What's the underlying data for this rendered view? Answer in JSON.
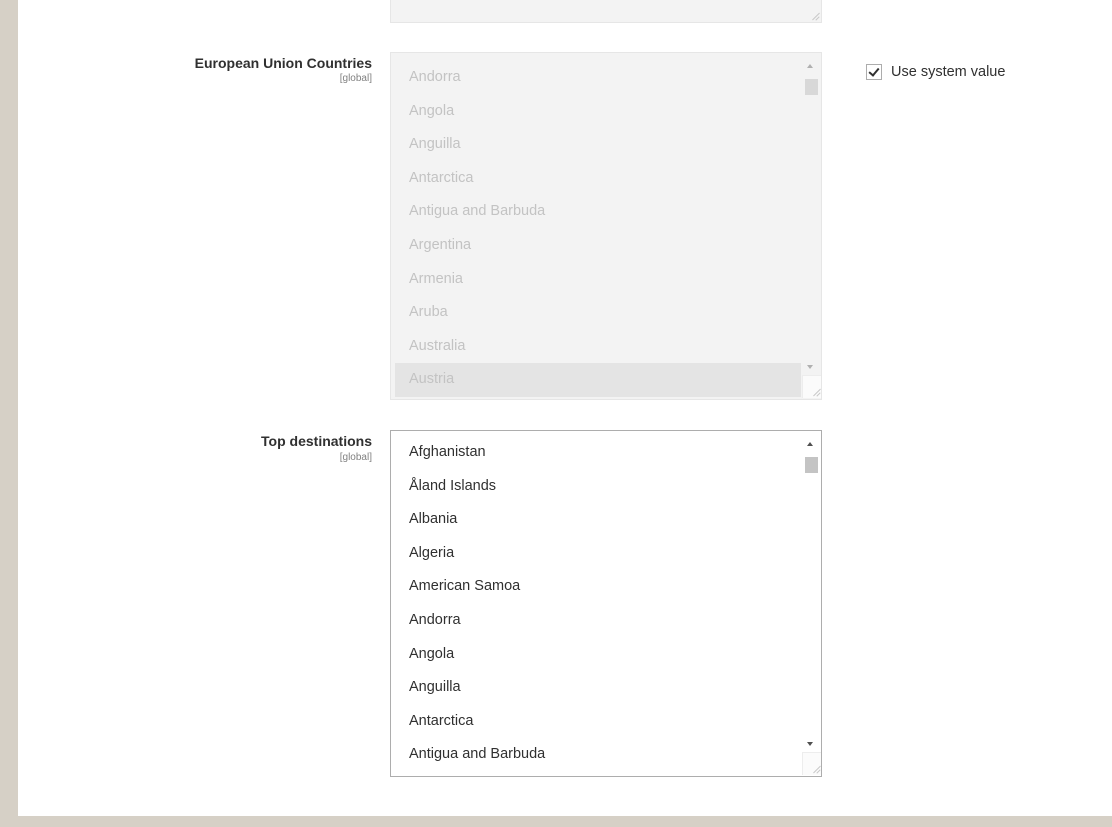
{
  "eu_countries": {
    "label": "European Union Countries",
    "scope": "[global]",
    "disabled": true,
    "options": [
      "Andorra",
      "Angola",
      "Anguilla",
      "Antarctica",
      "Antigua and Barbuda",
      "Argentina",
      "Armenia",
      "Aruba",
      "Australia",
      "Austria"
    ],
    "selected": [
      "Austria"
    ],
    "use_system_value": {
      "label": "Use system value",
      "checked": true
    }
  },
  "top_destinations": {
    "label": "Top destinations",
    "scope": "[global]",
    "disabled": false,
    "options": [
      "Afghanistan",
      "Åland Islands",
      "Albania",
      "Algeria",
      "American Samoa",
      "Andorra",
      "Angola",
      "Anguilla",
      "Antarctica",
      "Antigua and Barbuda"
    ],
    "selected": []
  }
}
